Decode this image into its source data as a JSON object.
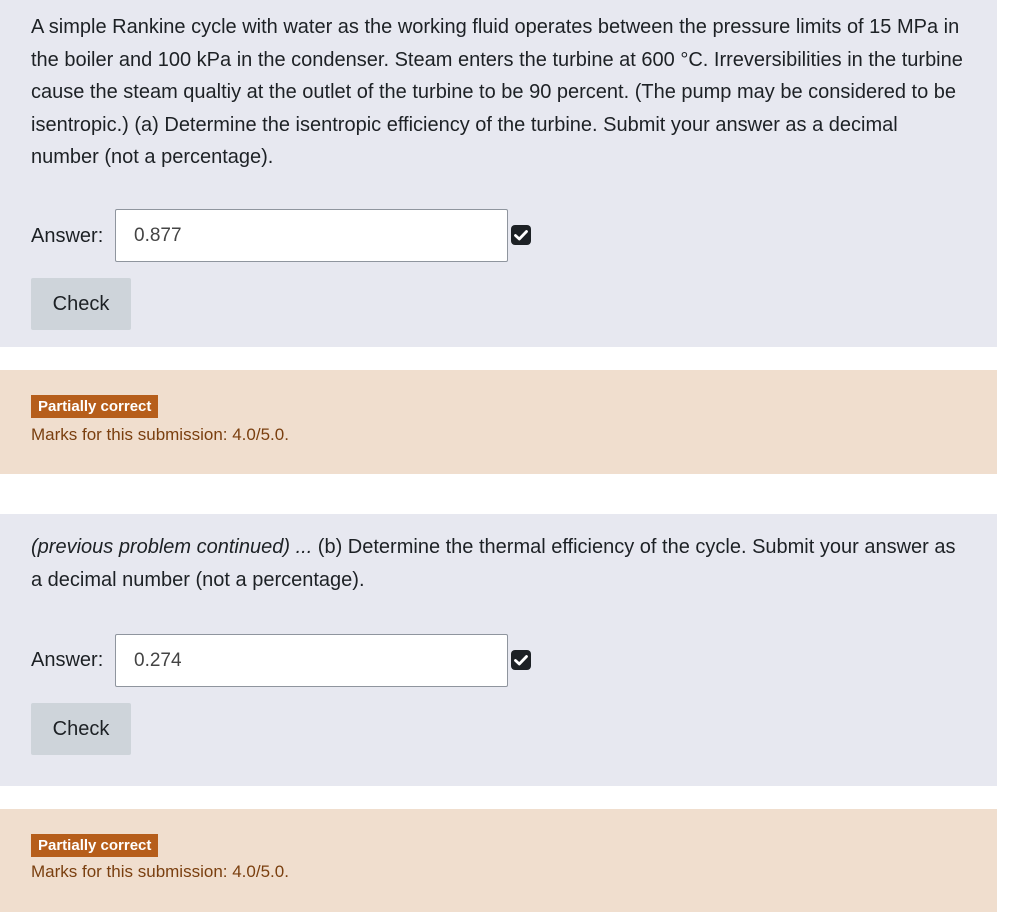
{
  "question1": {
    "text": "A simple Rankine cycle with water as the working fluid operates between the pressure limits of 15 MPa in the boiler and 100 kPa in the condenser.  Steam enters the turbine at 600 °C.  Irreversibilities in the turbine cause the steam qualtiy at the outlet of the turbine to be 90 percent.  (The pump may be considered to be isentropic.)  (a) Determine the isentropic efficiency of the turbine.  Submit your answer as a decimal number (not a percentage).",
    "answer_label": "Answer:",
    "answer_value": "0.877",
    "check_label": "Check",
    "correct_icon": "checkbox-checked-icon"
  },
  "feedback1": {
    "badge": "Partially correct",
    "marks": "Marks for this submission: 4.0/5.0."
  },
  "question2": {
    "intro": "(previous problem continued) ...",
    "text": " (b) Determine the thermal efficiency of the cycle.  Submit your answer as a decimal number (not a percentage).",
    "answer_label": "Answer:",
    "answer_value": "0.274",
    "check_label": "Check",
    "correct_icon": "checkbox-checked-icon"
  },
  "feedback2": {
    "badge": "Partially correct",
    "marks": "Marks for this submission: 4.0/5.0."
  },
  "colors": {
    "panel_bg": "#e7e8f0",
    "feedback_bg": "#f0dece",
    "badge_bg": "#b65e1b",
    "button_bg": "#ced4da"
  }
}
